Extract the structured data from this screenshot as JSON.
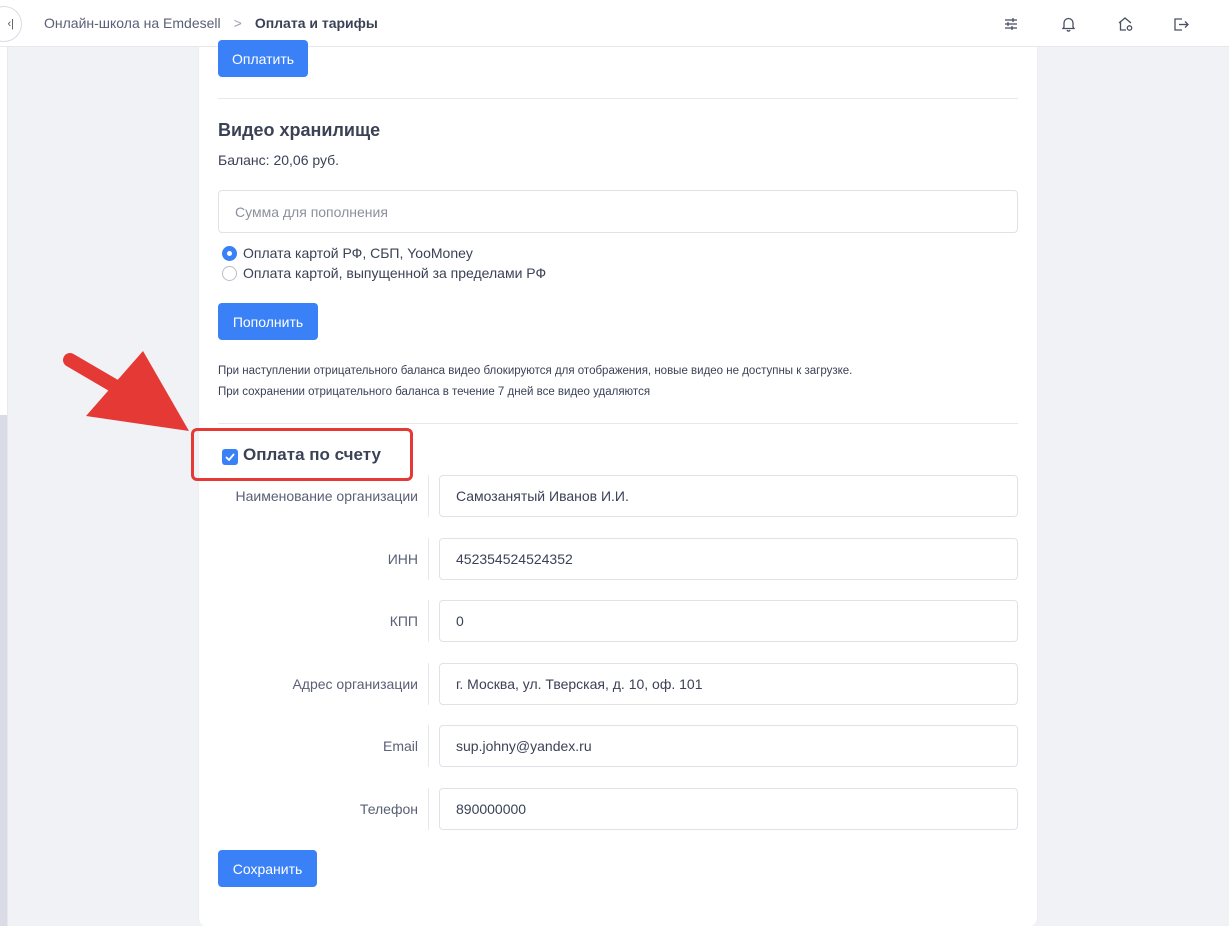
{
  "breadcrumb": {
    "school": "Онлайн-школа на Emdesell",
    "separator": ">",
    "current": "Оплата и тарифы"
  },
  "collapse_glyph": "‹|",
  "top_icons": [
    "sliders-icon",
    "bell-icon",
    "home-settings-icon",
    "logout-icon"
  ],
  "pay_button_label": "Оплатить",
  "video": {
    "title": "Видео хранилище",
    "balance": "Баланс: 20,06 руб.",
    "amount_placeholder": "Сумма для пополнения",
    "payment_options": [
      {
        "label": "Оплата картой РФ, СБП, YooMoney",
        "selected": true
      },
      {
        "label": "Оплата картой, выпущенной за пределами РФ",
        "selected": false
      }
    ],
    "topup_label": "Пополнить",
    "note_1": "При наступлении отрицательного баланса видео блокируются для отображения, новые видео не доступны к загрузке.",
    "note_2": "При сохранении отрицательного баланса в течение 7 дней все видео удаляются"
  },
  "invoice": {
    "label": "Оплата по счету",
    "checked": true,
    "fields": {
      "org_name": {
        "label": "Наименование организации",
        "value": "Самозанятый Иванов И.И."
      },
      "inn": {
        "label": "ИНН",
        "value": "452354524524352"
      },
      "kpp": {
        "label": "КПП",
        "value": "0"
      },
      "address": {
        "label": "Адрес организации",
        "value": "г. Москва, ул. Тверская, д. 10, оф. 101"
      },
      "email": {
        "label": "Email",
        "value": "sup.johny@yandex.ru"
      },
      "phone": {
        "label": "Телефон",
        "value": "890000000"
      }
    },
    "save_label": "Сохранить"
  },
  "colors": {
    "accent": "#3a80f6",
    "annotation": "#e53935"
  }
}
